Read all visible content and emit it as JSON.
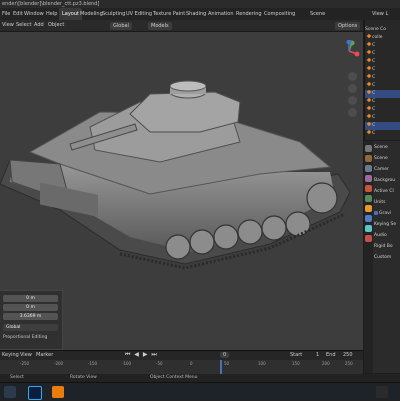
{
  "window": {
    "title": "ender\\[blender]\\blender_ctt.pz3.blend]"
  },
  "menu": [
    "File",
    "Edit",
    "Window",
    "Help"
  ],
  "workspaces": [
    "Layout",
    "Modeling",
    "Sculpting",
    "UV Editing",
    "Texture Paint",
    "Shading",
    "Animation",
    "Rendering",
    "Compositing"
  ],
  "active_workspace": "Layout",
  "scene_label": "Scene",
  "view_layer_label": "View L",
  "viewport_header": {
    "view": "View",
    "select": "Select",
    "add": "Add",
    "object": "Object",
    "transform": "Global",
    "shading": "Models",
    "options": "Options"
  },
  "outliner": {
    "rows": [
      "Scene Co",
      "colle",
      "C",
      "C",
      "C",
      "C",
      "C",
      "C",
      "C",
      "C",
      "C",
      "C",
      "C",
      "C"
    ]
  },
  "properties": {
    "rows": [
      "Scene",
      "Scene",
      "Camer",
      "Backgrou",
      "Active Cl",
      "Units",
      "Gravi",
      "Keying Se",
      "Audio",
      "Rigid Bo",
      "Custom"
    ]
  },
  "operator_panel": {
    "fields": [
      "0 m",
      "0 m",
      "3.6369 m"
    ],
    "orient": "Global",
    "prop_edit": "Proportional Editing"
  },
  "timeline": {
    "menu": [
      "Keying",
      "View",
      "Marker"
    ],
    "start_label": "Start",
    "start_value": "1",
    "end_label": "End",
    "end_value": "250",
    "current_frame": "0",
    "ticks": [
      "-250",
      "-200",
      "-150",
      "-100",
      "-50",
      "0",
      "50",
      "100",
      "150",
      "200",
      "250"
    ]
  },
  "status": {
    "left": "Select",
    "middle": "Rotate View",
    "right": "Object Context Menu"
  }
}
